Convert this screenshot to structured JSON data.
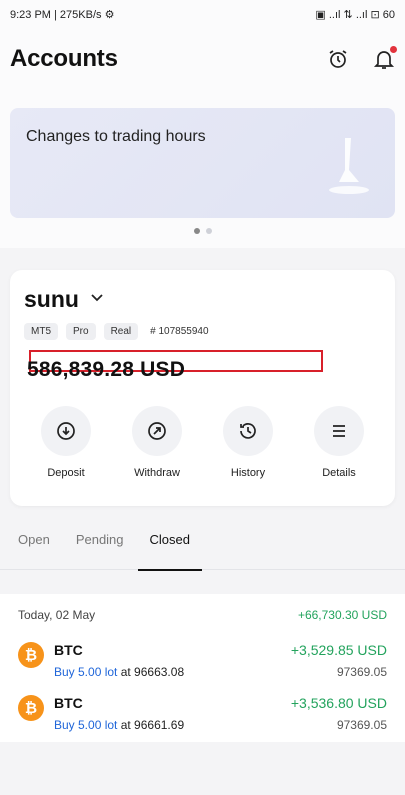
{
  "status": {
    "left": "9:23 PM | 275KB/s ⚙",
    "right": "▣ ..ıl ⇅ ..ıl ⊡ 60"
  },
  "header": {
    "title": "Accounts",
    "icons": [
      "alarm-clock-icon",
      "bell-icon"
    ]
  },
  "banner": {
    "title": "Changes to trading hours"
  },
  "account": {
    "name": "sunu",
    "tags": [
      "MT5",
      "Pro",
      "Real"
    ],
    "id": "# 107855940",
    "balance": "586,839.28 USD"
  },
  "actions": [
    {
      "label": "Deposit",
      "icon": "deposit-icon"
    },
    {
      "label": "Withdraw",
      "icon": "withdraw-icon"
    },
    {
      "label": "History",
      "icon": "history-icon"
    },
    {
      "label": "Details",
      "icon": "details-icon"
    }
  ],
  "tabs": [
    "Open",
    "Pending",
    "Closed"
  ],
  "list": {
    "day": "Today, 02 May",
    "day_total": "+66,730.30 USD",
    "trades": [
      {
        "symbol": "BTC",
        "pl": "+3,529.85 USD",
        "buy": "Buy 5.00 lot",
        "at": "at 96663.08",
        "close": "97369.05"
      },
      {
        "symbol": "BTC",
        "pl": "+3,536.80 USD",
        "buy": "Buy 5.00 lot",
        "at": "at 96661.69",
        "close": "97369.05"
      }
    ]
  },
  "colors": {
    "accent_red": "#d8202a",
    "profit_green": "#23a35d",
    "link_blue": "#2066d9",
    "btc_orange": "#f7931a"
  }
}
